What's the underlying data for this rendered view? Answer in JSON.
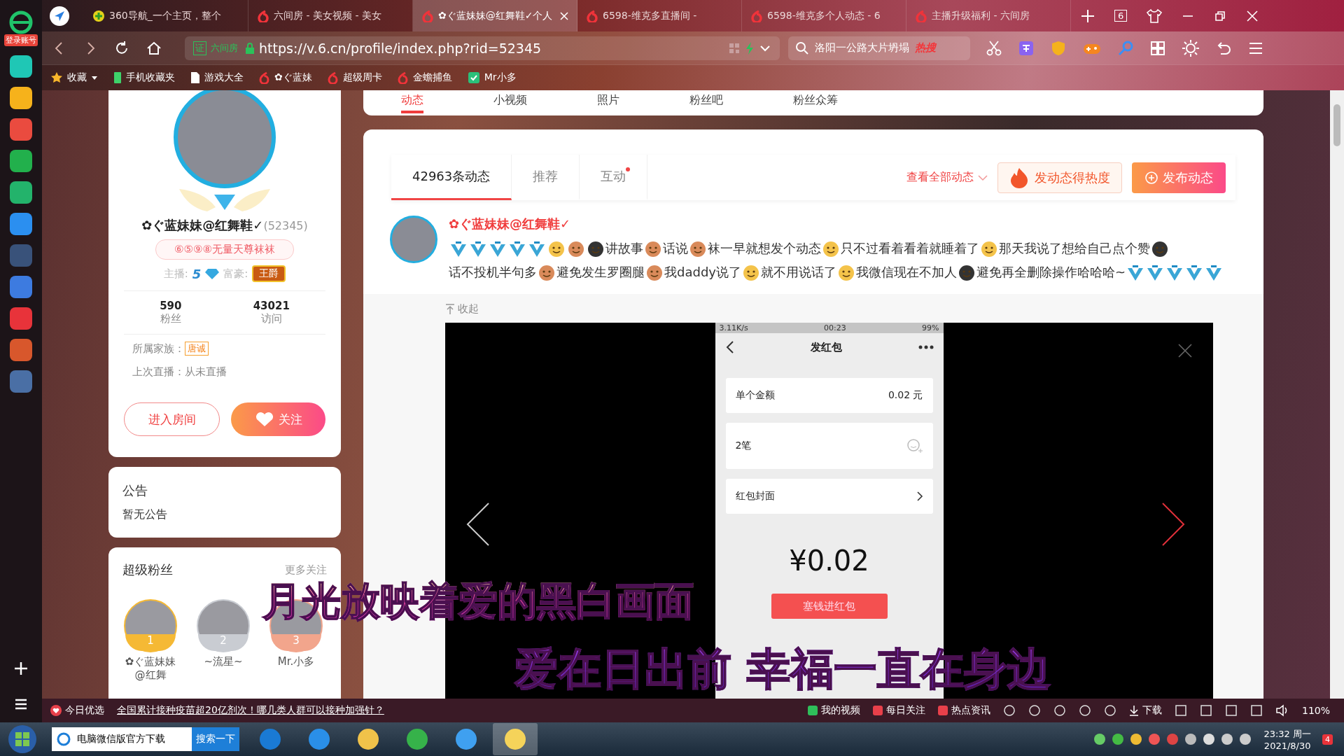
{
  "sidebar": {
    "login": "登录账号"
  },
  "tabs": [
    {
      "title": "360导航_一个主页，整个",
      "selected": false,
      "kind": "nav"
    },
    {
      "title": "六间房 - 美女视频 - 美女",
      "selected": false,
      "kind": "six"
    },
    {
      "title": "✿ぐ蓝妹妹@红舞鞋✓个人",
      "selected": true,
      "kind": "six"
    },
    {
      "title": "6598-维克多直播间 -",
      "selected": false,
      "kind": "six"
    },
    {
      "title": "6598-维克多个人动态 - 6",
      "selected": false,
      "kind": "six"
    },
    {
      "title": "主播升级福利 - 六间房",
      "selected": false,
      "kind": "six"
    }
  ],
  "tab_count": "6",
  "address": {
    "cert": "证",
    "site": "六间房",
    "url": "https://v.6.cn/profile/index.php?rid=52345"
  },
  "search": {
    "value": "洛阳一公路大片坍塌",
    "hot": "热搜"
  },
  "bookmarks": [
    {
      "label": "收藏",
      "kind": "star"
    },
    {
      "label": "手机收藏夹",
      "kind": "phone"
    },
    {
      "label": "游戏大全",
      "kind": "doc"
    },
    {
      "label": "✿ぐ蓝妹",
      "kind": "six"
    },
    {
      "label": "超级周卡",
      "kind": "six"
    },
    {
      "label": "金蟾捕鱼",
      "kind": "six"
    },
    {
      "label": "Mr小多",
      "kind": "green"
    }
  ],
  "nav": [
    {
      "label": "动态",
      "selected": true
    },
    {
      "label": "小视频",
      "selected": false
    },
    {
      "label": "照片",
      "selected": false
    },
    {
      "label": "粉丝吧",
      "selected": false
    },
    {
      "label": "粉丝众筹",
      "selected": false
    }
  ],
  "profile": {
    "name": "✿ぐ蓝妹妹@红舞鞋✓",
    "rid": "(52345)",
    "tagline": "⑥⑤⑨⑧无量天尊袜袜",
    "anchor_label": "主播:",
    "anchor_level": "5",
    "rich_label": "富豪:",
    "rich_badge": "王爵",
    "stats": [
      {
        "value": "590",
        "label": "粉丝"
      },
      {
        "value": "43021",
        "label": "访问"
      }
    ],
    "family_label": "所属家族：",
    "family": "唐诚",
    "last_live": "上次直播：从未直播",
    "enter": "进入房间",
    "follow": "关注"
  },
  "notice": {
    "title": "公告",
    "text": "暂无公告"
  },
  "fans": {
    "title": "超级粉丝",
    "more": "更多关注",
    "items": [
      {
        "rank": "1",
        "name": "✿ぐ蓝妹妹@红舞",
        "color": "#f5b935"
      },
      {
        "rank": "2",
        "name": "~流星~",
        "color": "#c9ccd2"
      },
      {
        "rank": "3",
        "name": "Mr.小多",
        "color": "#f2a58c"
      }
    ]
  },
  "feed": {
    "tabs": [
      {
        "label": "42963条动态",
        "selected": true,
        "dot": false
      },
      {
        "label": "推荐",
        "selected": false,
        "dot": false
      },
      {
        "label": "互动",
        "selected": false,
        "dot": true
      }
    ],
    "view_all": "查看全部动态",
    "hot_button": "发动态得热度",
    "post_button": "发布动态"
  },
  "post": {
    "author": "✿ぐ蓝妹妹@红舞鞋✓",
    "segments": [
      {
        "kind": "five"
      },
      {
        "kind": "five"
      },
      {
        "kind": "five"
      },
      {
        "kind": "five"
      },
      {
        "kind": "five"
      },
      {
        "kind": "emoji"
      },
      {
        "kind": "emoji"
      },
      {
        "kind": "emoji"
      },
      {
        "kind": "text",
        "text": "讲故事"
      },
      {
        "kind": "emoji"
      },
      {
        "kind": "text",
        "text": "话说"
      },
      {
        "kind": "emoji"
      },
      {
        "kind": "text",
        "text": "袜一早就想发个动态"
      },
      {
        "kind": "emoji"
      },
      {
        "kind": "text",
        "text": "只不过看着看着就睡着了"
      },
      {
        "kind": "emoji"
      },
      {
        "kind": "text",
        "text": "那天我说了想给自己点个赞"
      },
      {
        "kind": "emoji"
      },
      {
        "kind": "text",
        "text": "话不投机半句多"
      },
      {
        "kind": "emoji"
      },
      {
        "kind": "text",
        "text": "避免发生罗圈腿"
      },
      {
        "kind": "emoji"
      },
      {
        "kind": "text",
        "text": "我daddy说了"
      },
      {
        "kind": "emoji"
      },
      {
        "kind": "text",
        "text": "就不用说话了"
      },
      {
        "kind": "emoji"
      },
      {
        "kind": "text",
        "text": "我微信现在不加人"
      },
      {
        "kind": "emoji"
      },
      {
        "kind": "text",
        "text": "避免再全删除操作哈哈哈~"
      },
      {
        "kind": "five"
      },
      {
        "kind": "five"
      },
      {
        "kind": "five"
      },
      {
        "kind": "five"
      },
      {
        "kind": "five"
      }
    ],
    "collapse": "收起"
  },
  "phone": {
    "speed": "3.11K/s",
    "time": "00:23",
    "battery": "99%",
    "title": "发红包",
    "amount_label": "单个金额",
    "amount": "0.02 元",
    "count": "2笔",
    "cover": "红包封面",
    "total": "¥0.02",
    "submit": "塞钱进红包"
  },
  "lyrics": [
    "月光放映着爱的黑白画面",
    "爱在日出前  幸福一直在身边"
  ],
  "status_bar": {
    "today": "今日优选",
    "news": "全国累计接种疫苗超20亿剂次！哪几类人群可以接种加强针？",
    "items": [
      "我的视频",
      "每日关注",
      "热点资讯"
    ],
    "download": "下载",
    "zoom": "110%"
  },
  "taskbar": {
    "search": "电脑微信版官方下载",
    "search_button": "搜索一下",
    "time": "23:32 周一",
    "date": "2021/8/30",
    "notifications": "4"
  }
}
